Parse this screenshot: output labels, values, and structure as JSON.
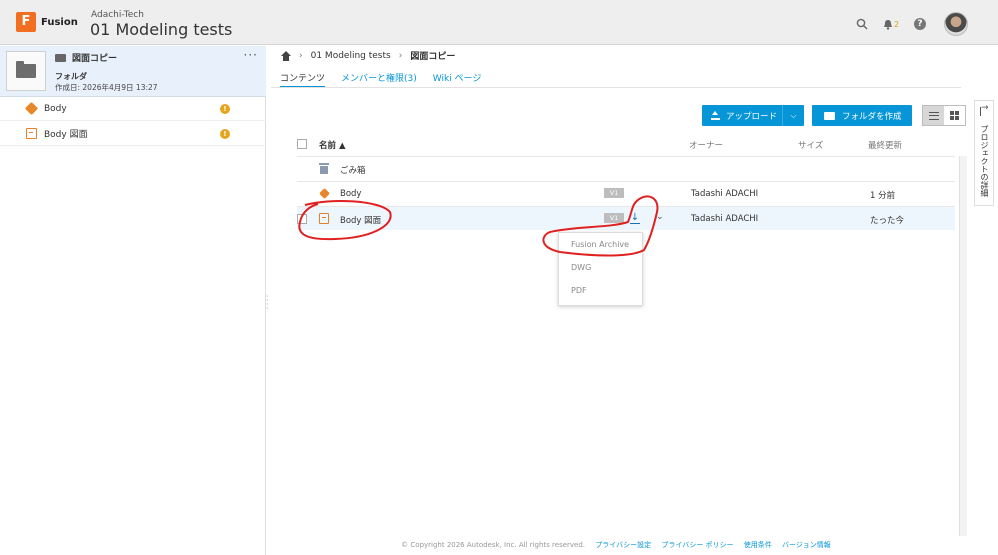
{
  "header": {
    "brand": "Fusion",
    "brand_letter": "F",
    "hub": "Adachi-Tech",
    "project": "01 Modeling tests",
    "notification_count": "2",
    "help_label": "?",
    "icons": [
      "search-icon",
      "bell-icon",
      "help-icon",
      "avatar"
    ]
  },
  "left_panel": {
    "folder_title": "図面コピー",
    "folder_type": "フォルダ",
    "created": "作成日:  2026年4月9日 13:27",
    "more_label": "···",
    "items": [
      {
        "label": "Body",
        "icon": "body-icon",
        "badge": "!"
      },
      {
        "label": "Body 図面",
        "icon": "drawing-icon",
        "badge": "!"
      }
    ]
  },
  "breadcrumb": {
    "project": "01 Modeling tests",
    "current": "図面コピー",
    "separator": "›"
  },
  "tabs": [
    "コンテンツ",
    "メンバーと権限(3)",
    "Wiki ページ"
  ],
  "toolbar": {
    "upload_label": "アップロード",
    "upload_chevron": "⌵",
    "new_folder_label": "フォルダを作成"
  },
  "table": {
    "columns": {
      "name": "名前 ▲",
      "owner": "オーナー",
      "size": "サイズ",
      "modified": "最終更新"
    },
    "rows": [
      {
        "name": "ごみ箱",
        "icon": "trash-icon",
        "version": "",
        "owner": "",
        "modified": ""
      },
      {
        "name": "Body",
        "icon": "body-icon",
        "version": "V1",
        "owner": "Tadashi ADACHI",
        "modified": "1 分前"
      },
      {
        "name": "Body 図面",
        "icon": "drawing-icon",
        "version": "V1",
        "owner": "Tadashi ADACHI",
        "modified": "たった今"
      }
    ],
    "download_glyph": "↓",
    "chevron_glyph": "⌄"
  },
  "download_menu": [
    "Fusion Archive",
    "DWG",
    "PDF"
  ],
  "footer": {
    "copyright": "© Copyright 2026 Autodesk, Inc. All rights reserved.",
    "links": [
      "プライバシー設定",
      "プライバシー ポリシー",
      "使用条件",
      "バージョン情報"
    ]
  },
  "right_rail": {
    "label": "プロジェクトの詳細"
  },
  "colors": {
    "accent": "#0696d7",
    "brand": "#f26f21",
    "warning": "#e4a61e",
    "annotation": "#e02020"
  }
}
